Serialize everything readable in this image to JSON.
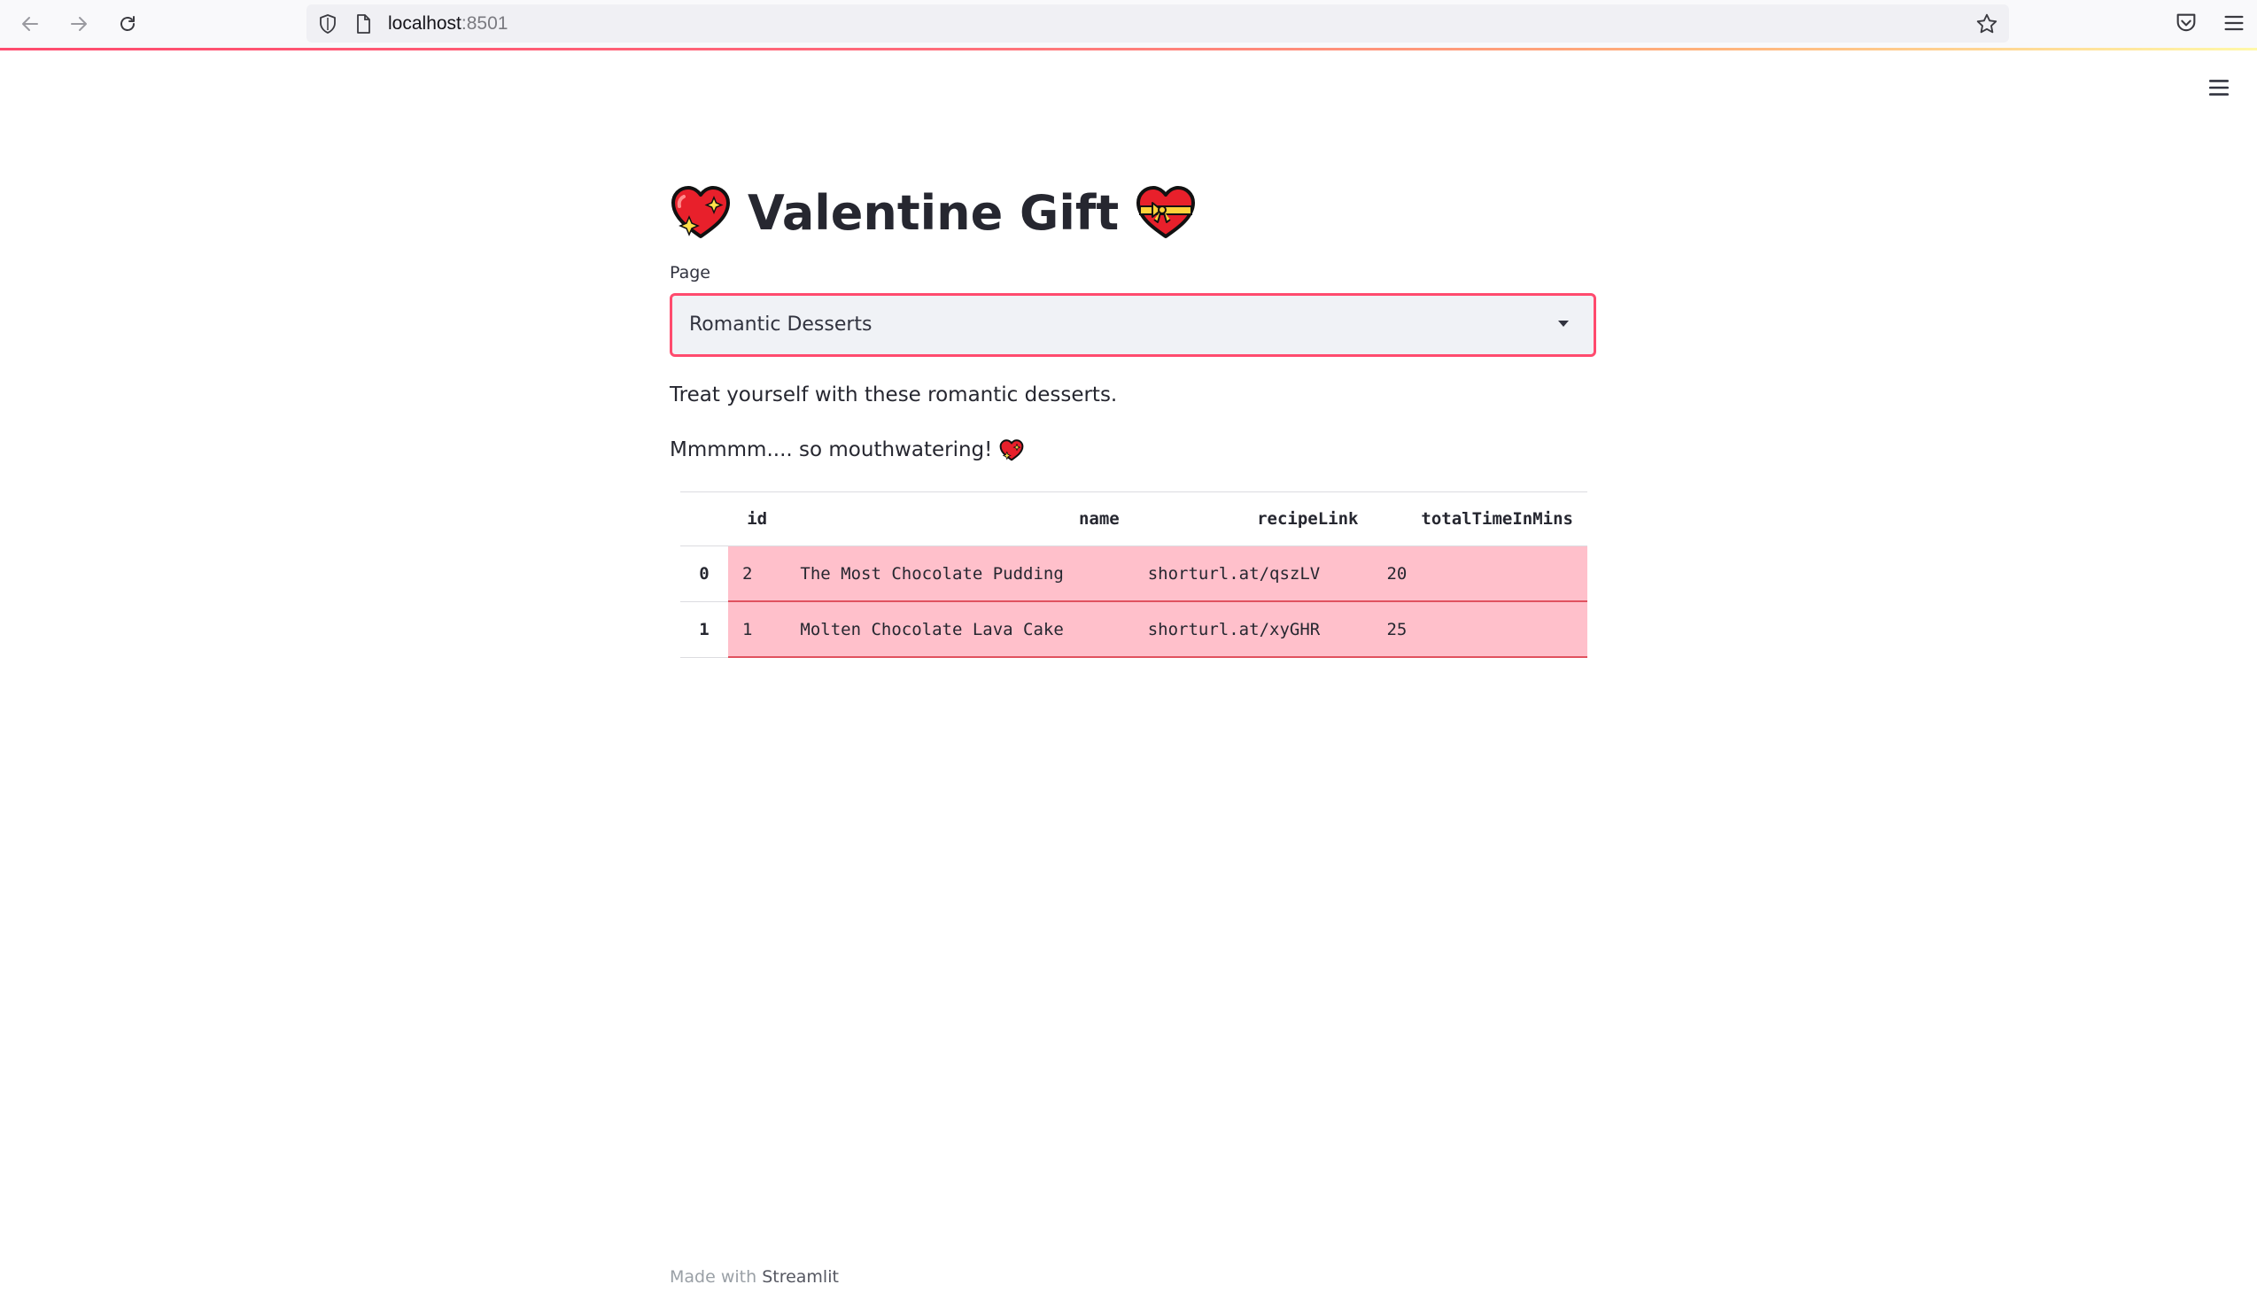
{
  "browser": {
    "url_host": "localhost",
    "url_port": ":8501"
  },
  "app": {
    "title": "Valentine Gift",
    "select": {
      "label": "Page",
      "value": "Romantic Desserts"
    },
    "paragraph1": "Treat yourself with these romantic desserts.",
    "paragraph2": "Mmmmm.... so mouthwatering!",
    "table": {
      "columns": [
        "id",
        "name",
        "recipeLink",
        "totalTimeInMins"
      ],
      "rows": [
        {
          "index": "0",
          "id": "2",
          "name": "The Most Chocolate Pudding",
          "recipeLink": "shorturl.at/qszLV",
          "totalTimeInMins": "20"
        },
        {
          "index": "1",
          "id": "1",
          "name": "Molten Chocolate Lava Cake",
          "recipeLink": "shorturl.at/xyGHR",
          "totalTimeInMins": "25"
        }
      ]
    },
    "footer": {
      "prefix": "Made with ",
      "brand": "Streamlit"
    }
  },
  "colors": {
    "accent": "#ff4b6e",
    "row_highlight": "#ffc0cb",
    "text": "#262730"
  },
  "icons": {
    "title_left": "sparkling-heart-icon",
    "title_right": "heart-with-ribbon-icon",
    "paragraph2": "sparkling-heart-icon"
  }
}
